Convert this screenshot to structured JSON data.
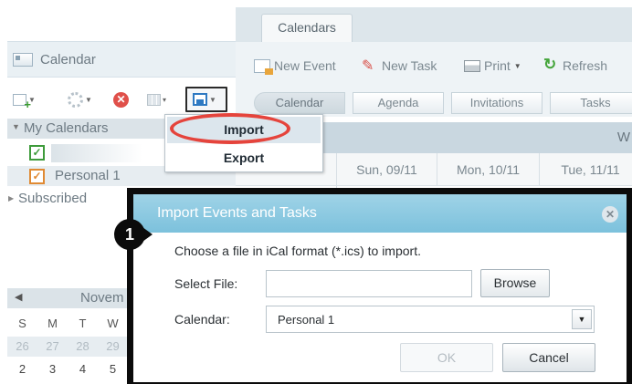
{
  "sidebar": {
    "title": "Calendar",
    "my_calendars_label": "My Calendars",
    "calendars": [
      {
        "name": "",
        "color": "#3e9b3b",
        "checked": true
      },
      {
        "name": "Personal 1",
        "color": "#e08a33",
        "checked": true
      }
    ],
    "subscribed_label": "Subscribed",
    "mini_calendar": {
      "month_label": "Novem",
      "day_headers": [
        "S",
        "M",
        "T",
        "W"
      ],
      "week1": [
        "26",
        "27",
        "28",
        "29"
      ],
      "week2": [
        "2",
        "3",
        "4",
        "5"
      ]
    }
  },
  "main": {
    "tab_label": "Calendars",
    "toolbar": {
      "new_event": "New Event",
      "new_task": "New Task",
      "print": "Print",
      "refresh": "Refresh"
    },
    "view_tabs": [
      "Calendar",
      "Agenda",
      "Invitations",
      "Tasks"
    ],
    "week_label": "W",
    "day_headers": [
      "Sun, 09/11",
      "Mon, 10/11",
      "Tue, 11/11"
    ]
  },
  "dropdown": {
    "items": [
      "Import",
      "Export"
    ],
    "highlight_color": "#e5443c"
  },
  "dialog": {
    "title": "Import Events and Tasks",
    "intro": "Choose a file in iCal format (*.ics) to import.",
    "select_file_label": "Select File:",
    "file_value": "",
    "browse_label": "Browse",
    "calendar_label": "Calendar:",
    "calendar_value": "Personal 1",
    "ok_label": "OK",
    "cancel_label": "Cancel",
    "title_bar_color": "#7cc1dc"
  },
  "annotation": {
    "step_number": "1"
  },
  "icons": {
    "close": "close-icon",
    "dropdown": "chevron-down-icon",
    "refresh": "refresh-icon",
    "print": "print-icon"
  }
}
